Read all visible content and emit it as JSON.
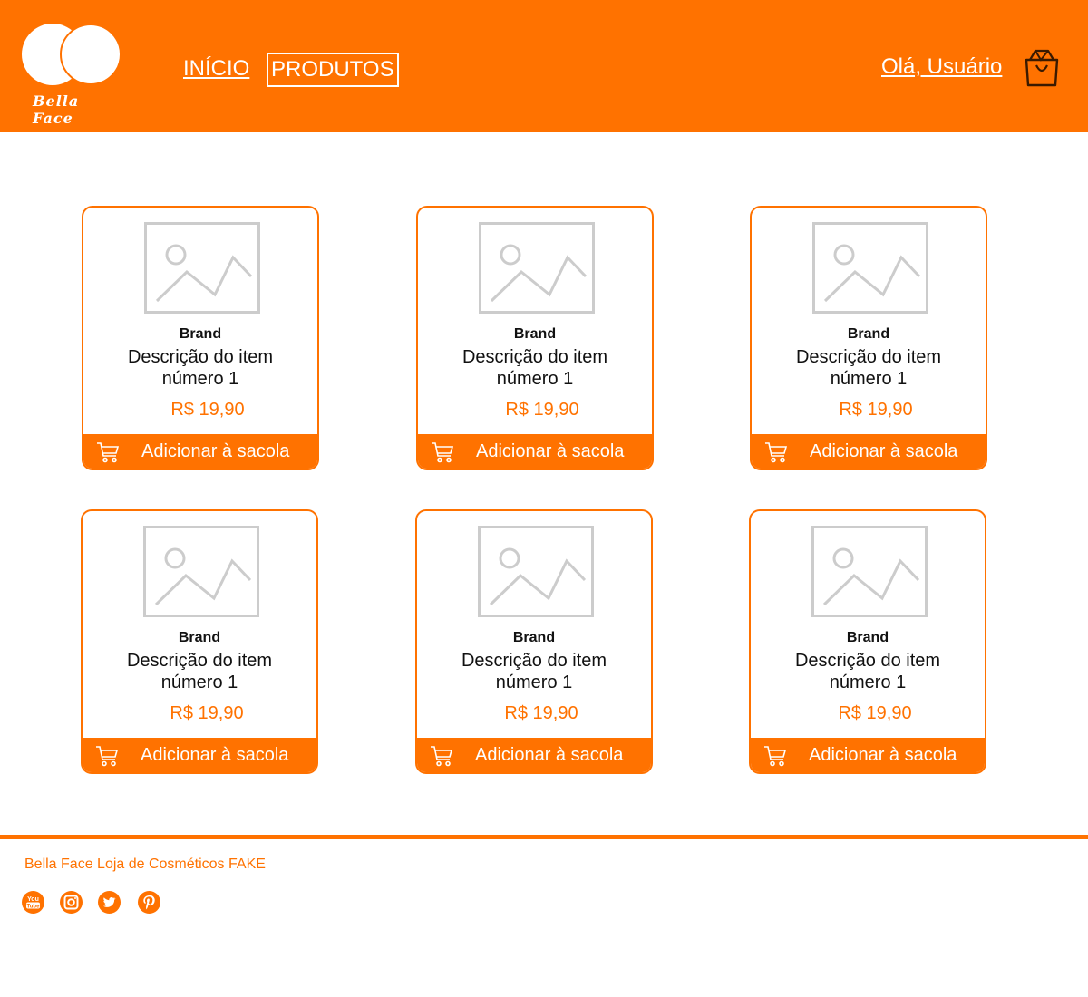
{
  "header": {
    "logo_text": "Bella Face",
    "nav": {
      "home": "INÍCIO",
      "products": "PRODUTOS"
    },
    "greeting": "Olá, Usuário",
    "bag_icon": "shopping-bag-icon"
  },
  "products": [
    {
      "brand": "Brand",
      "desc1": "Descrição do item",
      "desc2": "número 1",
      "price": "R$ 19,90",
      "button": "Adicionar à sacola"
    },
    {
      "brand": "Brand",
      "desc1": "Descrição do item",
      "desc2": "número 1",
      "price": "R$ 19,90",
      "button": "Adicionar à sacola"
    },
    {
      "brand": "Brand",
      "desc1": "Descrição do item",
      "desc2": "número 1",
      "price": "R$ 19,90",
      "button": "Adicionar à sacola"
    },
    {
      "brand": "Brand",
      "desc1": "Descrição do item",
      "desc2": "número 1",
      "price": "R$ 19,90",
      "button": "Adicionar à sacola"
    },
    {
      "brand": "Brand",
      "desc1": "Descrição do item",
      "desc2": "número 1",
      "price": "R$ 19,90",
      "button": "Adicionar à sacola"
    },
    {
      "brand": "Brand",
      "desc1": "Descrição do item",
      "desc2": "número 1",
      "price": "R$ 19,90",
      "button": "Adicionar à sacola"
    }
  ],
  "footer": {
    "text": "Bella Face Loja de Cosméticos FAKE",
    "social": [
      "youtube-icon",
      "instagram-icon",
      "twitter-icon",
      "pinterest-icon"
    ]
  },
  "colors": {
    "accent": "#ff7200",
    "background": "#ffffff",
    "placeholder": "#cccccc"
  }
}
